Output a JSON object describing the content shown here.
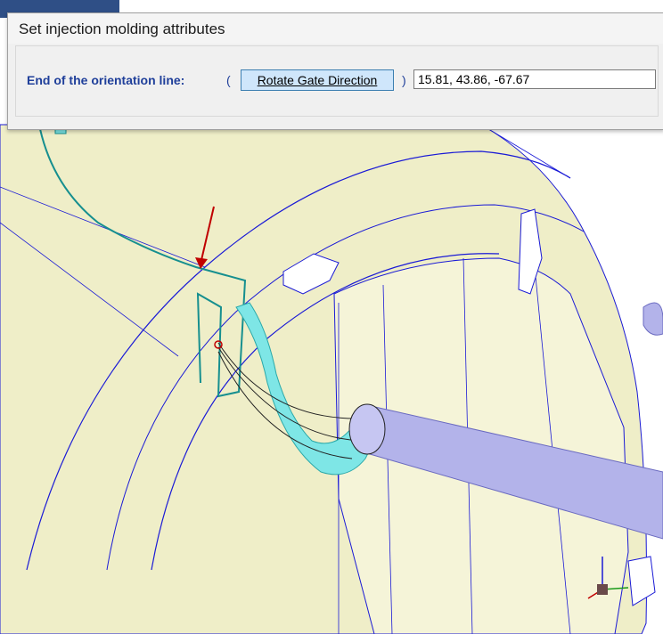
{
  "dialog": {
    "title": "Set injection molding attributes",
    "field_label": "End of the orientation line:",
    "paren_open": "(",
    "paren_close": ")",
    "rotate_button_label": "Rotate Gate Direction",
    "coord_value": "15.81, 43.86, -67.67"
  },
  "colors": {
    "part_surface": "#efeec8",
    "edge_lines": "#1a1ad6",
    "runner": "#7ee6e6",
    "sprue": "#b3b3ea",
    "gate_outline": "#168f8f",
    "arrow": "#c00000"
  }
}
